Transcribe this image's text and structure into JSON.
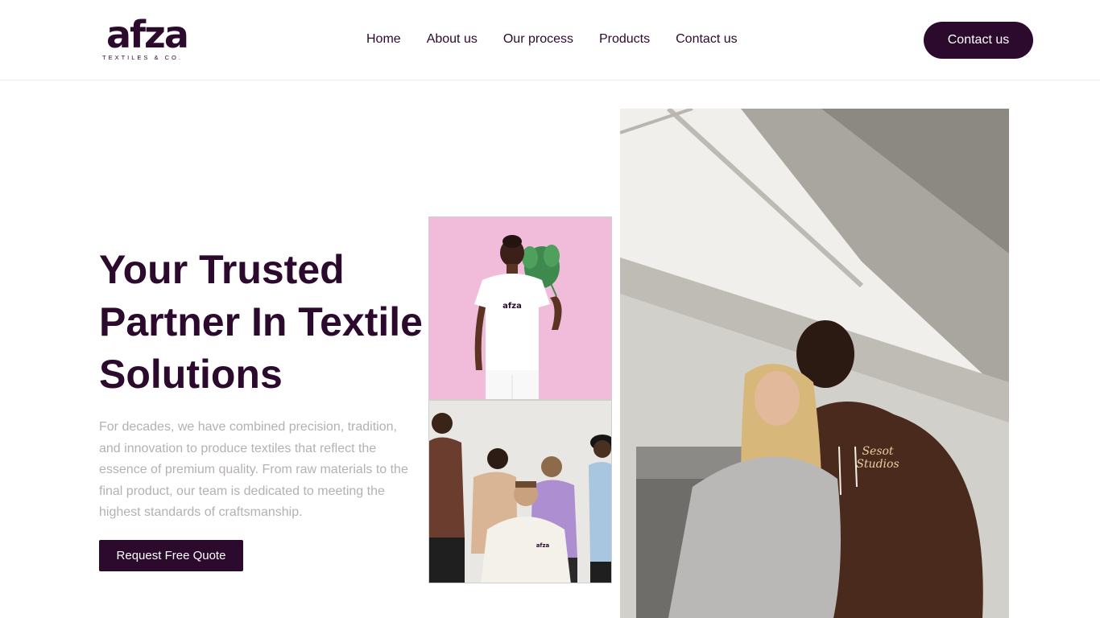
{
  "brand": {
    "logo_text": "afza",
    "logo_subtext": "TEXTILES & CO.",
    "color_primary": "#2b0a2d"
  },
  "nav": {
    "items": [
      {
        "label": "Home"
      },
      {
        "label": "About us"
      },
      {
        "label": "Our process"
      },
      {
        "label": "Products"
      },
      {
        "label": "Contact us"
      }
    ]
  },
  "header": {
    "cta_label": "Contact us"
  },
  "hero": {
    "title_lines": [
      "Your Trusted",
      "Partner In Textile",
      "Solutions"
    ],
    "description_lines": [
      "For decades, we have combined precision, tradition,",
      "and innovation to produce textiles that reflect the",
      "essence of premium quality. From raw materials to the",
      "final product, our team is dedicated to meeting the",
      "highest standards of craftsmanship."
    ],
    "cta_label": "Request Free Quote"
  },
  "images": {
    "pink": {
      "shirt_print": "afza"
    },
    "group": {
      "hoodie_print": "afza"
    },
    "large": {
      "hoodie_print_line1": "Sesot",
      "hoodie_print_line2": "Studios"
    }
  }
}
